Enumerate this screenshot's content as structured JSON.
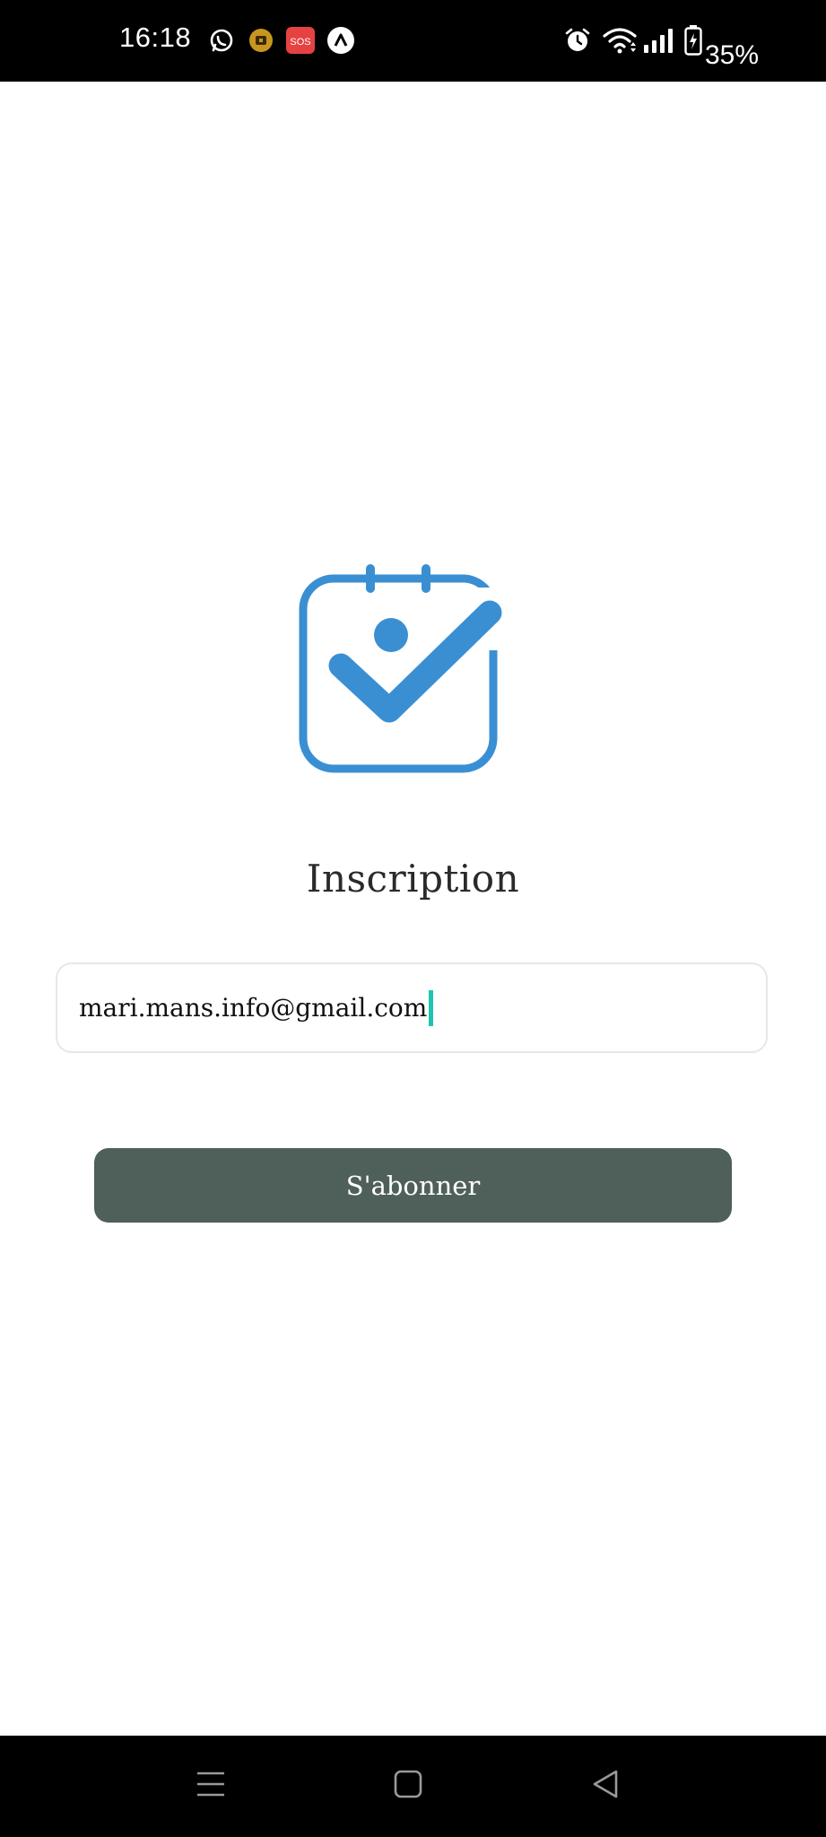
{
  "status_bar": {
    "time": "16:18",
    "notification_icons": [
      "whatsapp-icon",
      "lock-app-icon",
      "sos-icon",
      "app-a-icon"
    ],
    "sos_label": "SOS",
    "system_icons": [
      "alarm-icon",
      "wifi-icon",
      "signal-icon",
      "battery-charging-icon"
    ],
    "battery_percent": "35%"
  },
  "main": {
    "logo_icon": "calendar-check-icon",
    "title": "Inscription",
    "email_field": {
      "value": "mari.mans.info@gmail.com"
    },
    "subscribe_button": "S'abonner"
  },
  "nav_bar": {
    "buttons": [
      "recent-apps-icon",
      "home-icon",
      "back-icon"
    ]
  },
  "colors": {
    "accent_blue": "#3a8fd3",
    "button_bg": "#4f605a",
    "caret": "#1fc4b0",
    "field_border": "#e7e7e7"
  }
}
